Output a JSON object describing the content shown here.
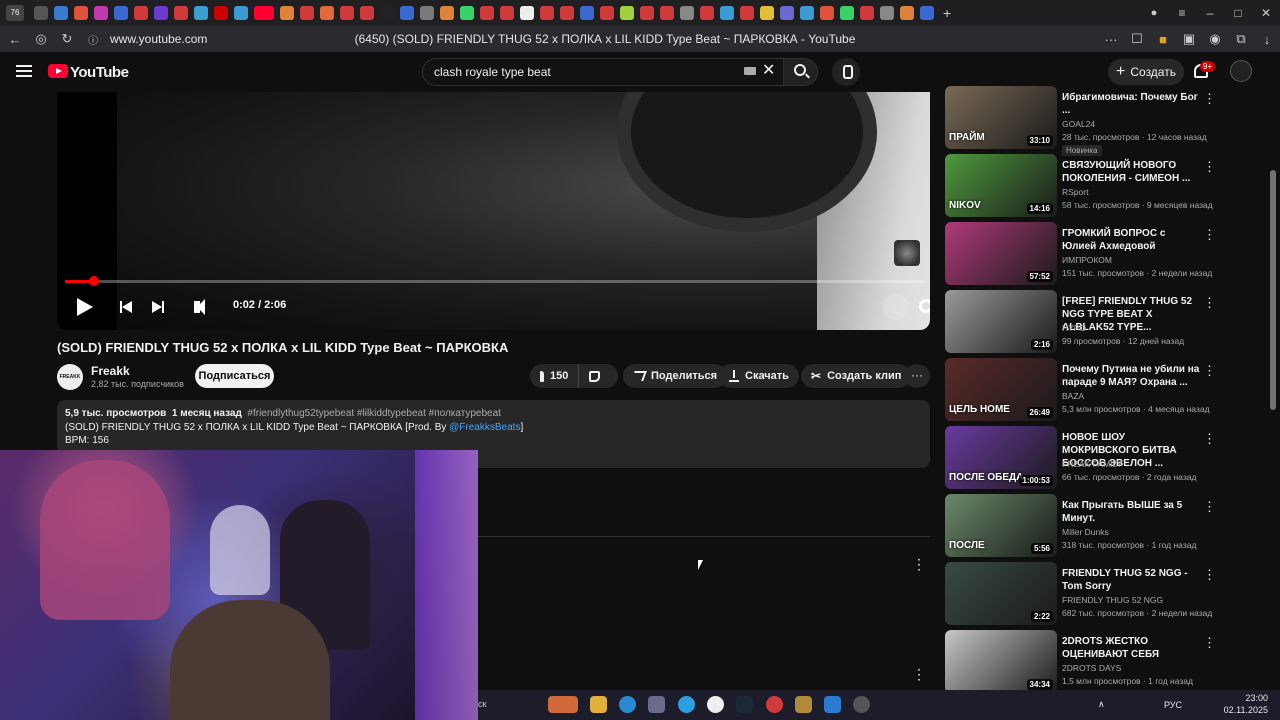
{
  "browser": {
    "tab_count": "76",
    "url": "www.youtube.com",
    "page_title": "(6450) (SOLD) FRIENDLY THUG 52 x ПОЛКА x LIL KIDD Type Beat ~ ПАРКОВКА - YouTube"
  },
  "header": {
    "logo_text": "YouTube",
    "search_value": "clash royale type beat",
    "create_label": "Создать",
    "notif_badge": "9+"
  },
  "player": {
    "time": "0:02 / 2:06",
    "progress": 0.02
  },
  "video": {
    "title": "(SOLD) FRIENDLY THUG 52 x ПОЛКА x LIL KIDD Type Beat ~ ПАРКОВКА",
    "channel": "Freakk",
    "channel_avatar_text": "FREAKK",
    "subscribers": "2,82 тыс. подписчиков",
    "subscribe_label": "Подписаться",
    "likes": "150",
    "share_label": "Поделиться",
    "download_label": "Скачать",
    "clip_label": "Создать клип",
    "description": {
      "views": "5,9 тыс. просмотров",
      "date": "1 месяц назад",
      "tags": "#friendlythug52typebeat #lilkiddtypebeat #полкатypebeat",
      "line1_prefix": "(SOLD) FRIENDLY THUG 52 x ПОЛКА x LIL KIDD Type Beat ~ ПАРКОВКА [Prod. By ",
      "line1_link": "@FreakksBeats",
      "line1_suffix": "]",
      "line2": "BPM: 156"
    }
  },
  "recommendations": [
    {
      "title": "Ибрагимовича: Почему Бог ...",
      "channel": "GOAL24",
      "meta": "28 тыс. просмотров · 12 часов назад",
      "duration": "33:10",
      "badge": "Новинка",
      "thumb_text": "ПРАЙМ",
      "thumb_color": "#7a6a55"
    },
    {
      "title": "СВЯЗУЮЩИЙ НОВОГО ПОКОЛЕНИЯ - СИМЕОН ...",
      "channel": "RSport",
      "meta": "58 тыс. просмотров · 9 месяцев назад",
      "duration": "14:16",
      "thumb_text": "NIKOV",
      "thumb_color": "#4f9a3d"
    },
    {
      "title": "ГРОМКИЙ ВОПРОС с Юлией Ахмедовой",
      "channel": "ИМПРОКОМ",
      "meta": "151 тыс. просмотров · 2 недели назад",
      "duration": "57:52",
      "thumb_text": "",
      "thumb_color": "#b03a7a"
    },
    {
      "title": "[FREE] FRIENDLY THUG 52 NGG TYPE BEAT X ALBLAK52 TYPE...",
      "channel": "HYPO",
      "meta": "99 просмотров · 12 дней назад",
      "duration": "2:16",
      "thumb_text": "",
      "thumb_color": "#9a9a9a"
    },
    {
      "title": "Почему Путина не убили на параде 9 МАЯ? Охрана ...",
      "channel": "BAZA",
      "meta": "5,3 млн просмотров · 4 месяца назад",
      "duration": "26:49",
      "thumb_text": "ЦЕЛЬ HOME",
      "thumb_color": "#5a2a2a"
    },
    {
      "title": "НОВОЕ ШОУ МОКРИВСКОГО БИТВА БОССОВ ЭВЕЛОН ...",
      "channel": "FREAK FAMILY",
      "meta": "66 тыс. просмотров · 2 года назад",
      "duration": "1:00:53",
      "thumb_text": "ПОСЛЕ ОБЕДА",
      "thumb_color": "#6a3aa0"
    },
    {
      "title": "Как Прыгать ВЫШЕ за 5 Минут.",
      "channel": "Miller Dunks",
      "meta": "318 тыс. просмотров · 1 год назад",
      "duration": "5:56",
      "thumb_text": "ПОСЛЕ",
      "thumb_color": "#6a8a6a"
    },
    {
      "title": "FRIENDLY THUG 52 NGG - Tom Sorry",
      "channel": "FRIENDLY THUG 52 NGG",
      "meta": "682 тыс. просмотров · 2 недели назад",
      "duration": "2:22",
      "thumb_text": "",
      "thumb_color": "#3a4a44"
    },
    {
      "title": "2DROTS ЖЕСТКО ОЦЕНИВАЮТ СЕБЯ",
      "channel": "2DROTS DAYS",
      "meta": "1,5 млн просмотров · 1 год назад",
      "duration": "34:34",
      "thumb_text": "",
      "thumb_color": "#c8c8c8"
    }
  ],
  "taskbar": {
    "search_fragment": "ск",
    "lang": "РУС",
    "time": "23:00",
    "date": "02.11.2025"
  },
  "colors": {
    "accent_red": "#ff0000",
    "bg": "#0f0f0f",
    "link": "#3ea6ff"
  }
}
